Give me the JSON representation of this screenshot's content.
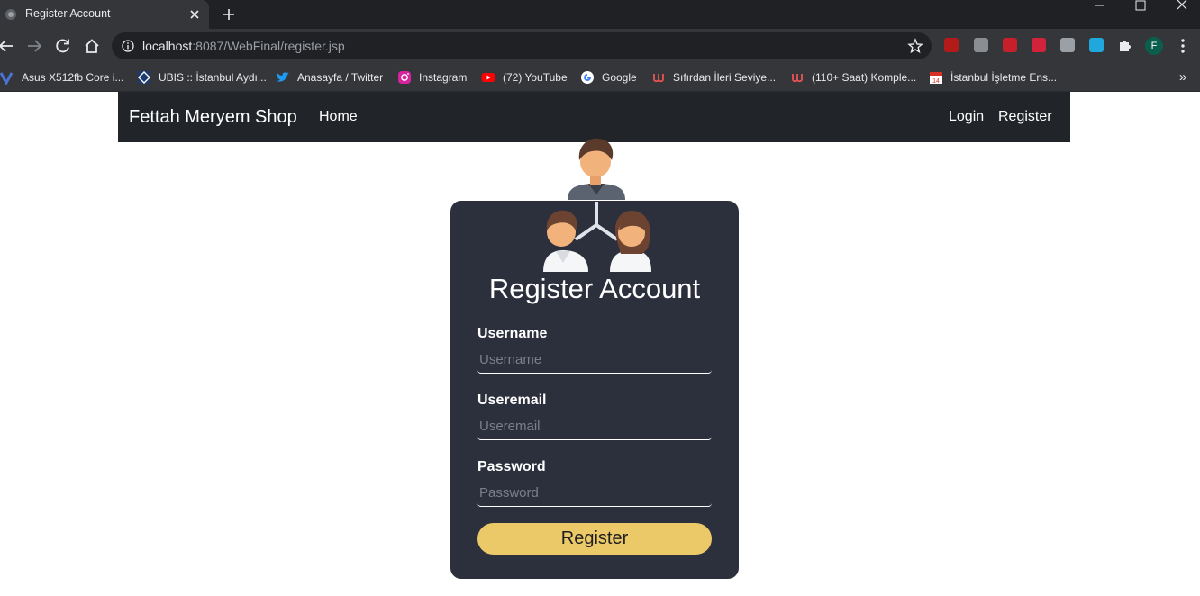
{
  "browser": {
    "tab_title": "Register Account",
    "url_host": "localhost",
    "url_rest": ":8087/WebFinal/register.jsp",
    "profile_initial": "F",
    "bookmarks": [
      {
        "label": "Asus X512fb Core i...",
        "icon": "vaio-icon"
      },
      {
        "label": "UBIS :: İstanbul Aydı...",
        "icon": "ubis-icon"
      },
      {
        "label": "Anasayfa / Twitter",
        "icon": "twitter-icon"
      },
      {
        "label": "Instagram",
        "icon": "instagram-icon"
      },
      {
        "label": "(72) YouTube",
        "icon": "youtube-icon"
      },
      {
        "label": "Google",
        "icon": "google-icon"
      },
      {
        "label": "Sıfırdan İleri Seviye...",
        "icon": "udemy-icon"
      },
      {
        "label": "(110+ Saat) Komple...",
        "icon": "udemy-icon"
      },
      {
        "label": "İstanbul İşletme Ens...",
        "icon": "calendar-icon"
      }
    ],
    "bookmarks_more": "»"
  },
  "nav": {
    "brand": "Fettah Meryem Shop",
    "home": "Home",
    "login": "Login",
    "register": "Register"
  },
  "form": {
    "title": "Register Account",
    "username_label": "Username",
    "username_placeholder": "Username",
    "email_label": "Useremail",
    "email_placeholder": "Useremail",
    "password_label": "Password",
    "password_placeholder": "Password",
    "submit": "Register"
  },
  "colors": {
    "navbar": "#212529",
    "card": "#2c2f3c",
    "button": "#ecc968"
  }
}
